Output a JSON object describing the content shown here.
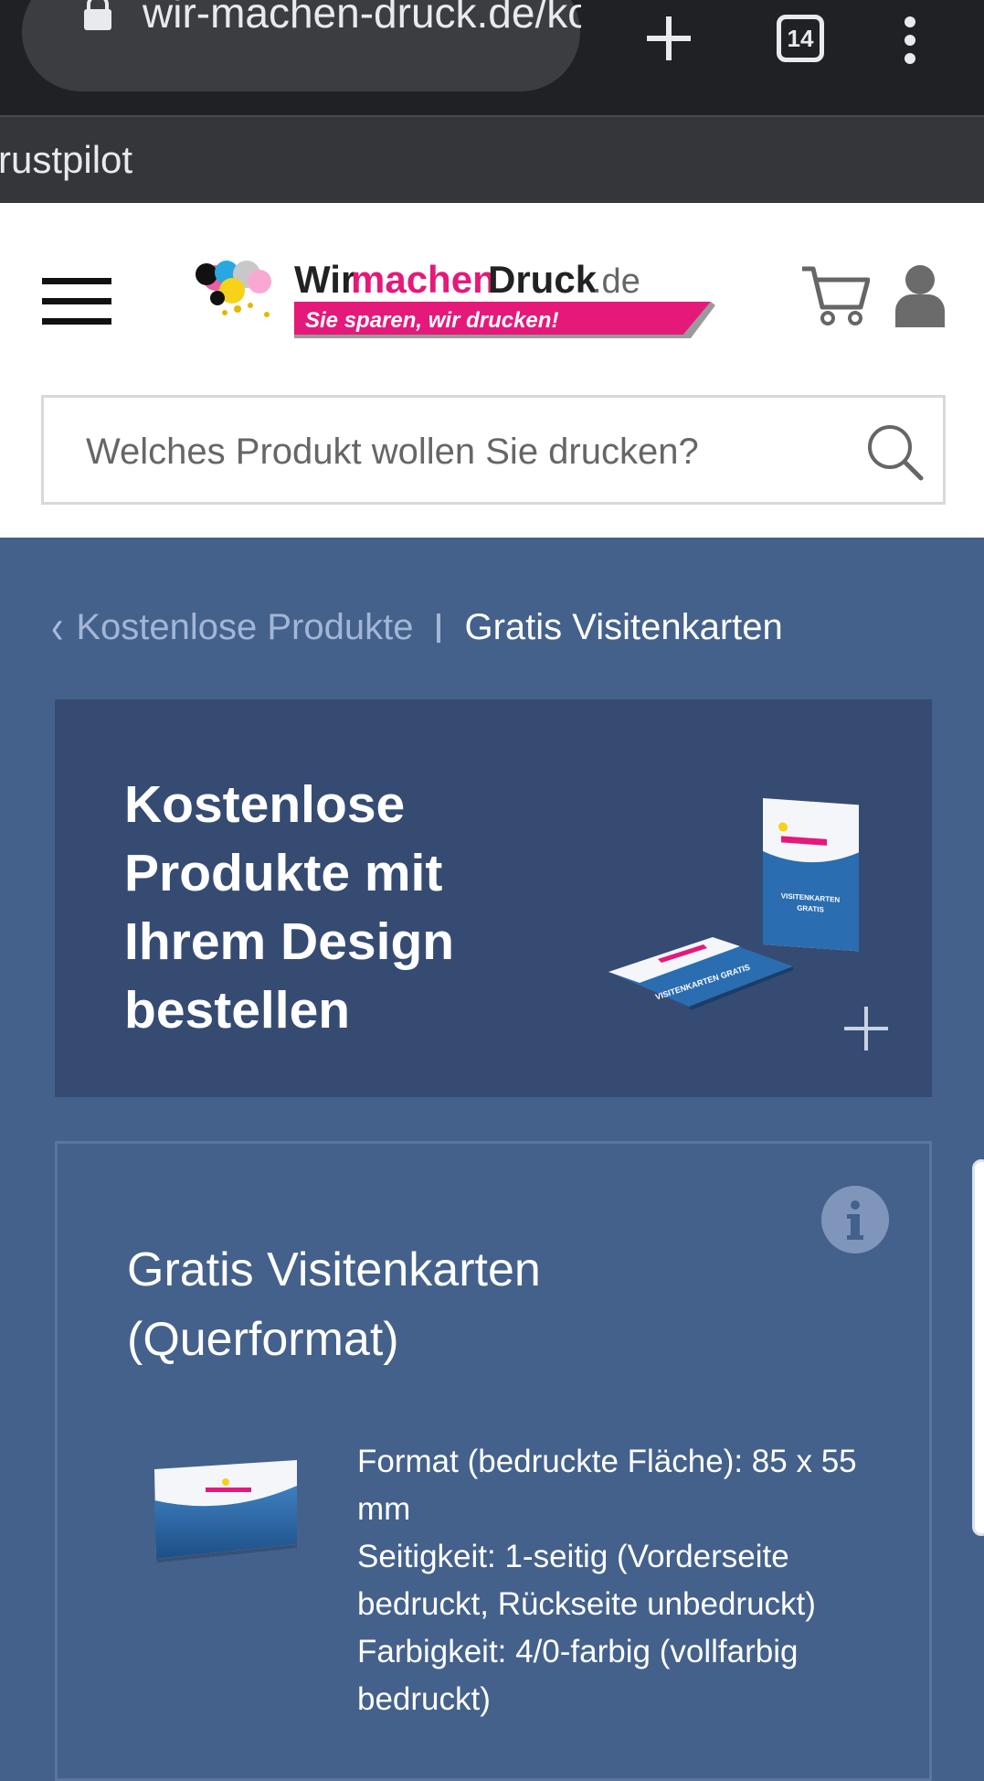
{
  "browser": {
    "url": "wir-machen-druck.de/kostenlose-produkte",
    "tab_count": "14",
    "bookmark_bar_text": "rustpilot"
  },
  "header": {
    "logo": {
      "name": "WirmachenDruck.de",
      "tagline": "Sie sparen, wir drucken!"
    },
    "search_placeholder": "Welches Produkt wollen Sie drucken?"
  },
  "breadcrumb": {
    "back_label": "Kostenlose Produkte",
    "current_label": "Gratis Visitenkarten"
  },
  "hero": {
    "title": "Kostenlose Produkte mit Ihrem Design bestellen",
    "card_text": "VISITENKARTEN GRATIS"
  },
  "product": {
    "title": "Gratis Visitenkarten (Querformat)",
    "specs": [
      "Format (bedruckte Fläche): 85 x 55 mm",
      "Seitigkeit: 1-seitig (Vorderseite bedruckt, Rückseite unbedruckt)",
      "Farbigkeit: 4/0-farbig (vollfarbig bedruckt)"
    ]
  },
  "colors": {
    "chrome_bg": "#202124",
    "page_blue": "#44618b",
    "hero_blue": "#364b72",
    "brand_pink": "#e5197a"
  },
  "icons": [
    "lock-icon",
    "plus-icon",
    "tab-switcher-icon",
    "kebab-menu-icon",
    "hamburger-icon",
    "cart-icon",
    "user-icon",
    "search-icon",
    "chevron-left-icon",
    "expand-plus-icon",
    "info-icon"
  ]
}
